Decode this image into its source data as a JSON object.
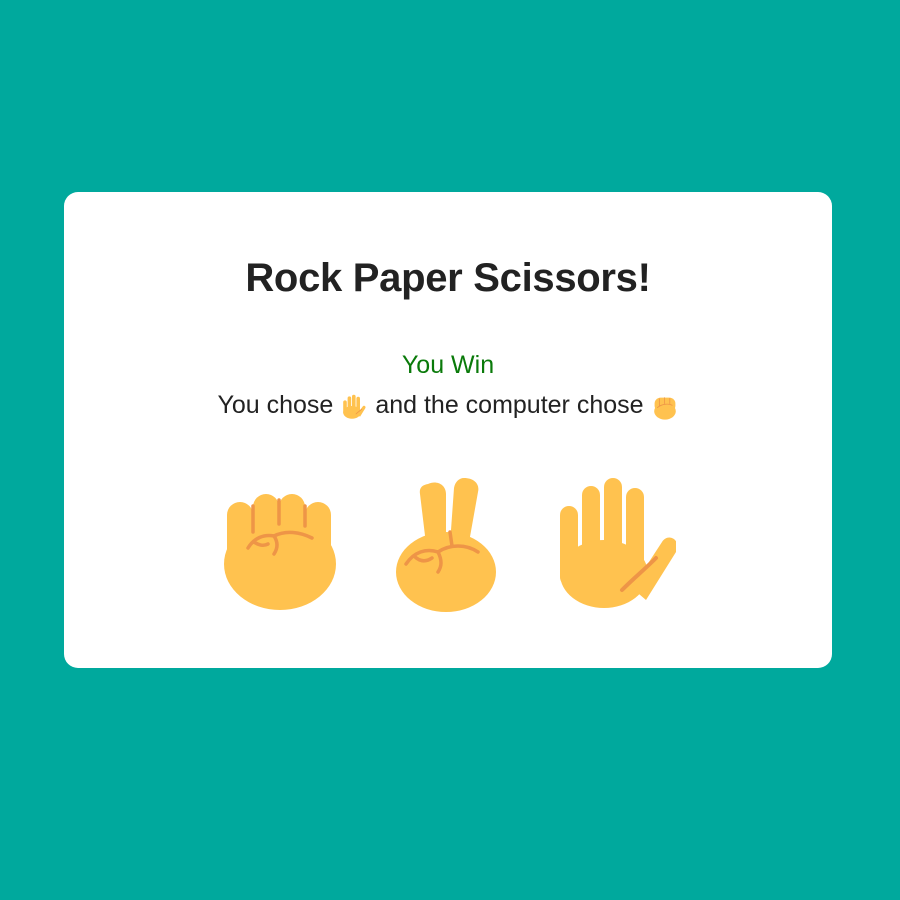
{
  "title": "Rock Paper Scissors!",
  "result": {
    "text": "You Win",
    "color": "#0a7a0a"
  },
  "summary": {
    "prefix": "You chose",
    "player_choice_icon": "paper-hand-icon",
    "middle": "and the computer chose",
    "computer_choice_icon": "rock-fist-icon"
  },
  "choices": [
    {
      "name": "rock",
      "icon": "fist-icon"
    },
    {
      "name": "scissors",
      "icon": "victory-hand-icon"
    },
    {
      "name": "paper",
      "icon": "raised-hand-icon"
    }
  ],
  "colors": {
    "background": "#00a99d",
    "card": "#ffffff",
    "hand_skin": "#ffc24f",
    "hand_shade": "#ee9547"
  }
}
